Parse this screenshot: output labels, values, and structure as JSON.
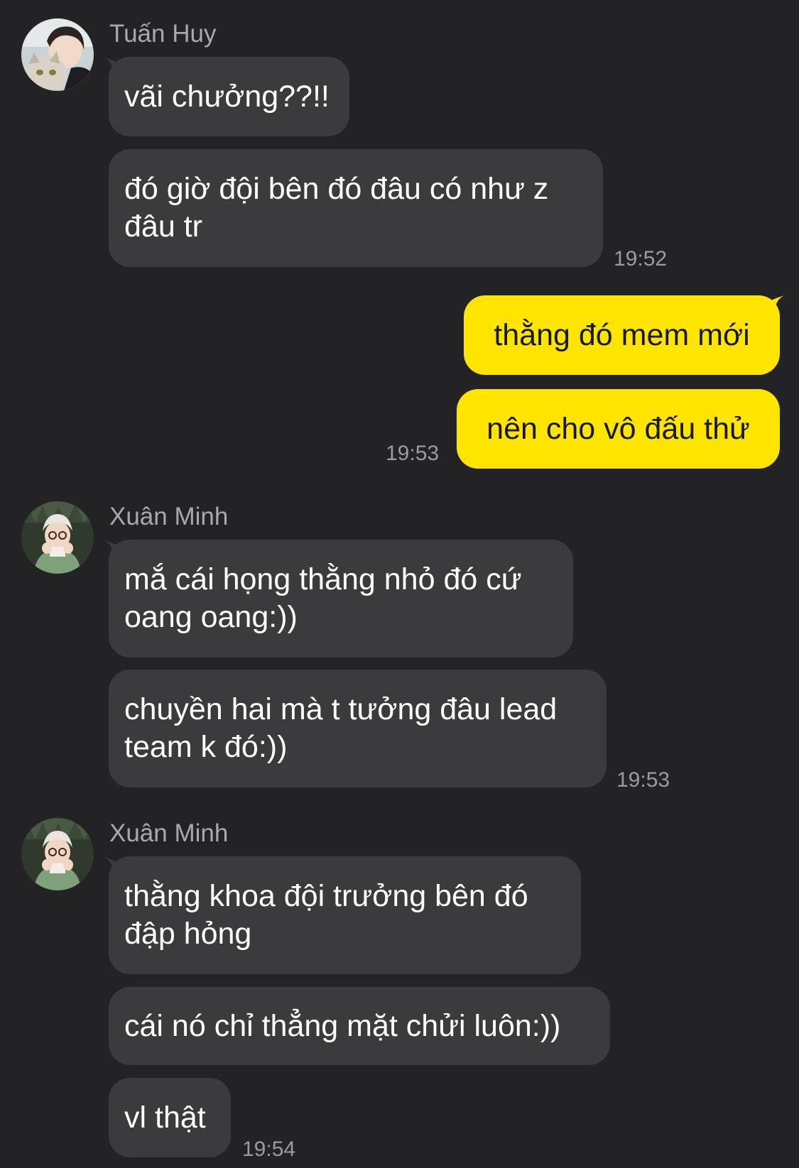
{
  "chat": {
    "groups": [
      {
        "sender": "Tuấn Huy",
        "avatar_icon": "profile-photo-person-with-cat",
        "messages": [
          "vãi chưởng??!!",
          "đó giờ đội bên đó đâu có như z\nđâu tr"
        ],
        "time": "19:52"
      },
      {
        "sender": "me",
        "messages": [
          "thằng đó mem mới",
          "nên cho vô đấu thử"
        ],
        "time": "19:53"
      },
      {
        "sender": "Xuân Minh",
        "avatar_icon": "profile-photo-girl-glasses",
        "messages": [
          "mắ cái họng thằng nhỏ đó cứ\noang oang:))",
          "chuyền hai mà t tưởng đâu lead\nteam k đó:))"
        ],
        "time": "19:53"
      },
      {
        "sender": "Xuân Minh",
        "avatar_icon": "profile-photo-girl-glasses",
        "messages": [
          "thằng khoa đội trưởng bên đó\nđập hỏng",
          "cái nó chỉ thẳng mặt chửi luôn:))",
          "vl thật"
        ],
        "time": "19:54"
      }
    ]
  },
  "colors": {
    "background": "#232325",
    "incoming_bubble": "#3b3b3e",
    "outgoing_bubble": "#fee500",
    "sender_name": "#a9a9ad",
    "timestamp": "#9c9ca0"
  }
}
